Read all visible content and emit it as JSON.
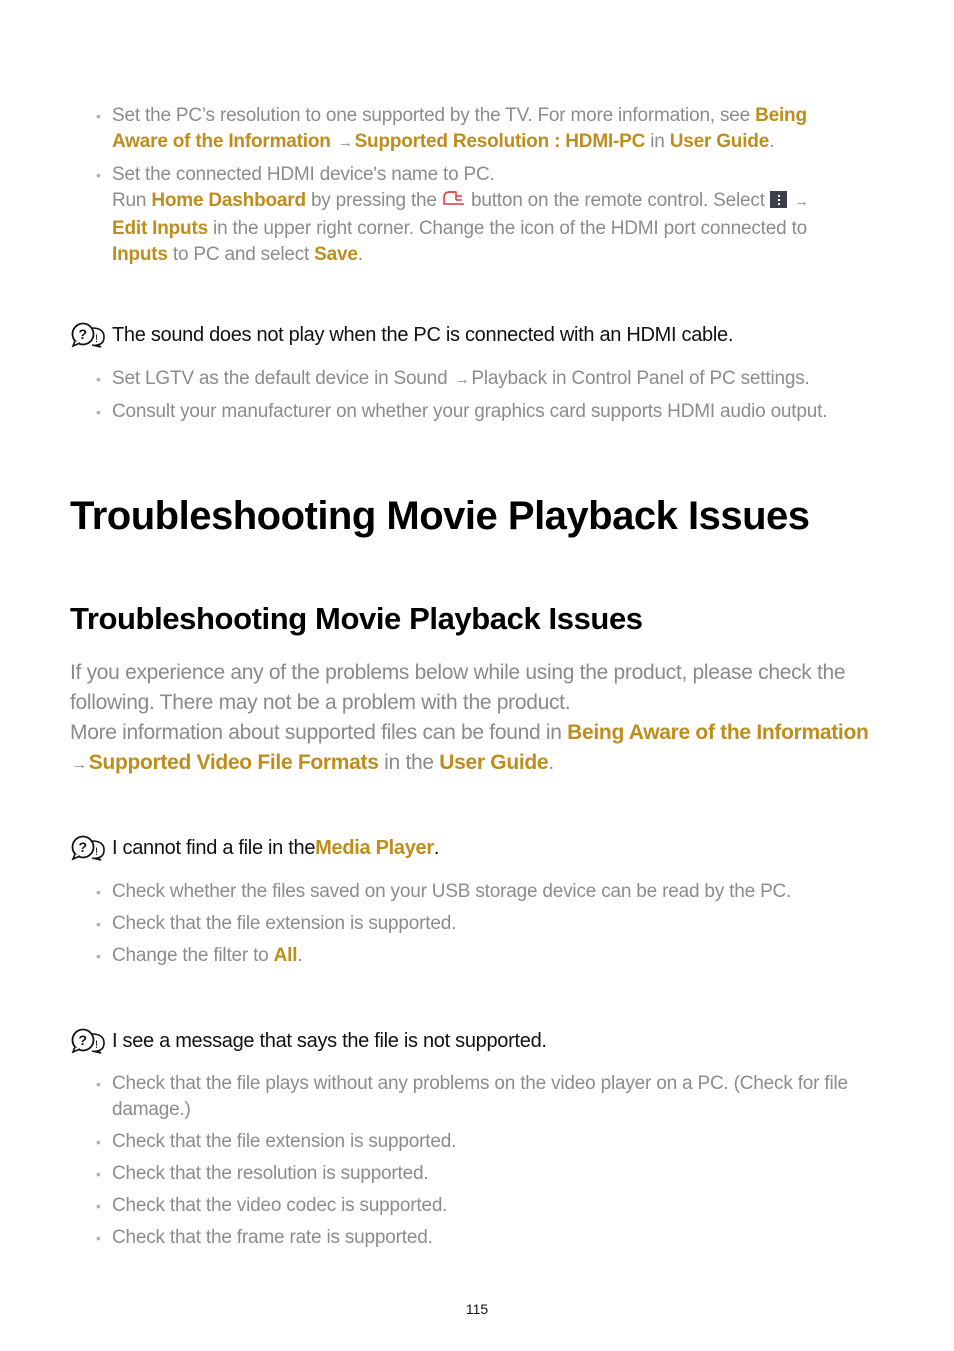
{
  "section1": {
    "bullets": [
      {
        "t1": "Set the PC’s resolution to one supported by the TV. For more information, see ",
        "link1": "Being Aware of the Information",
        "arrow": "→",
        "link2": "Supported Resolution : HDMI-PC",
        "t2": " in ",
        "link3": "User Guide",
        "t3": "."
      },
      {
        "line1": "Set the connected HDMI device's name to PC.",
        "t1": "Run ",
        "link1": "Home Dashboard",
        "t2": " by pressing the ",
        "t3": " button on the remote control. Select ",
        "arrow": "→",
        "link2": "Edit Inputs",
        "t4": " in the upper right corner. Change the icon of the HDMI port connected to ",
        "link3": "Inputs",
        "t5": " to PC and select ",
        "link4": "Save",
        "t6": "."
      }
    ]
  },
  "question1": {
    "text": "The sound does not play when the PC is connected with an HDMI cable.",
    "bullets": [
      {
        "t1": "Set LGTV as the default device in Sound",
        "arrow": "→",
        "t2": "Playback in Control Panel of PC settings."
      },
      {
        "t1": "Consult your manufacturer on whether your graphics card supports HDMI audio output."
      }
    ]
  },
  "title": "Troubleshooting Movie Playback Issues",
  "subtitle": "Troubleshooting Movie Playback Issues",
  "intro": {
    "line1": "If you experience any of the problems below while using the product, please check the following. There may not be a problem with the product.",
    "t1": "More information about supported files can be found in ",
    "link1": "Being Aware of the Information",
    "arrow": "→",
    "link2": "Supported Video File Formats",
    "t2": " in the ",
    "link3": "User Guide",
    "t3": "."
  },
  "question2": {
    "t1": "I cannot find a file in the ",
    "link1": "Media Player",
    "t2": ".",
    "bullets": [
      {
        "t1": "Check whether the files saved on your USB storage device can be read by the PC."
      },
      {
        "t1": "Check that the file extension is supported."
      },
      {
        "t1": "Change the filter to ",
        "link1": "All",
        "t2": "."
      }
    ]
  },
  "question3": {
    "text": "I see a message that says the file is not supported.",
    "bullets": [
      "Check that the file plays without any problems on the video player on a PC. (Check for file damage.)",
      "Check that the file extension is supported.",
      "Check that the resolution is supported.",
      "Check that the video codec is supported.",
      "Check that the frame rate is supported."
    ]
  },
  "page_number": "115",
  "colors": {
    "link": "#bf8d1c",
    "body_text": "#8a8a8a",
    "heading": "#000000",
    "remote_icon": "#e0393e"
  },
  "icons": {
    "question": "question-bubble-icon",
    "home": "home-button-icon",
    "menu": "more-menu-icon",
    "arrow": "arrow-right-icon"
  }
}
